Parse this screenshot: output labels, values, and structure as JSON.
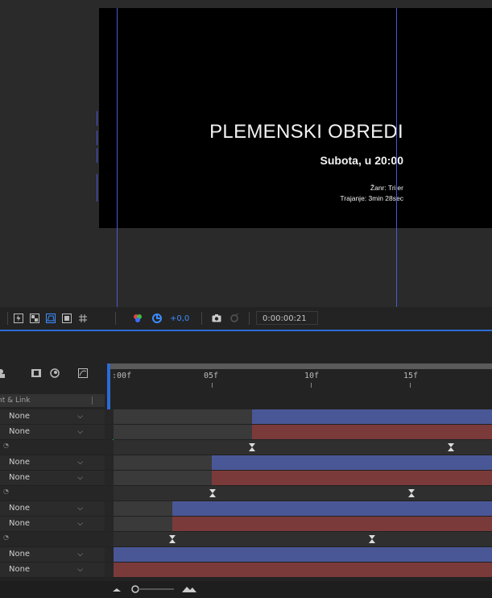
{
  "composition": {
    "title": "PLEMENSKI OBREDI",
    "date": "Subota, u 20:00",
    "genre": "Žanr: Triler",
    "duration": "Trajanje: 3min 28sec"
  },
  "viewer_toolbar": {
    "icons": [
      "fast-previews-icon",
      "transparency-grid-icon",
      "mask-visibility-icon",
      "region-of-interest-icon",
      "guides-grid-icon",
      "color-channels-icon",
      "reset-exposure-icon",
      "snapshot-icon",
      "show-snapshot-icon"
    ],
    "exposure": "+0,0",
    "timecode": "0:00:00:21"
  },
  "timeline": {
    "column_header": "nt & Link",
    "ruler_labels": [
      "):00f",
      "05f",
      "10f",
      "15f"
    ],
    "rows": [
      {
        "type": "select",
        "value": "None"
      },
      {
        "type": "select",
        "value": "None"
      },
      {
        "type": "keyframes"
      },
      {
        "type": "select",
        "value": "None"
      },
      {
        "type": "select",
        "value": "None"
      },
      {
        "type": "keyframes"
      },
      {
        "type": "select",
        "value": "None"
      },
      {
        "type": "select",
        "value": "None"
      },
      {
        "type": "keyframes"
      },
      {
        "type": "select",
        "value": "None"
      },
      {
        "type": "select",
        "value": "None"
      }
    ]
  },
  "colors": {
    "accent": "#2d6bd6",
    "guide": "#4a58d8",
    "work_area_green": "#2ecc40",
    "layer_blue": "#4a5796",
    "layer_red": "#7b3a3a"
  }
}
